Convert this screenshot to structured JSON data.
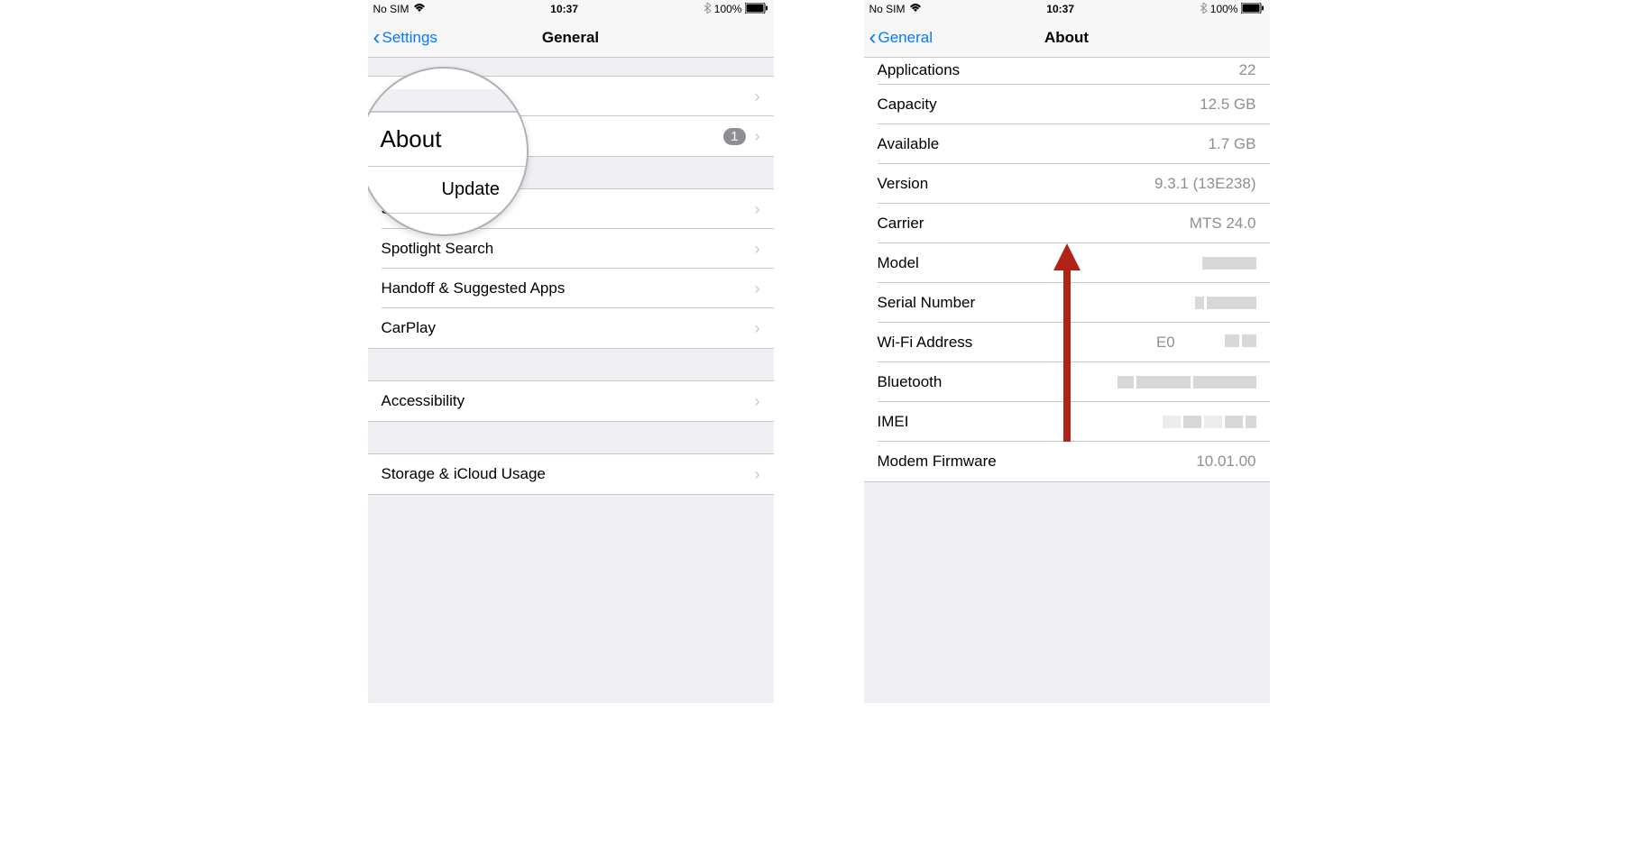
{
  "status": {
    "carrier": "No SIM",
    "time": "10:37",
    "battery": "100%"
  },
  "left": {
    "nav": {
      "back": "Settings",
      "title": "General"
    },
    "section1": [
      {
        "label": "About"
      },
      {
        "label": "Software Update",
        "badge": "1"
      }
    ],
    "section2": [
      {
        "label": "Siri"
      },
      {
        "label": "Spotlight Search"
      },
      {
        "label": "Handoff & Suggested Apps"
      },
      {
        "label": "CarPlay"
      }
    ],
    "section3": [
      {
        "label": "Accessibility"
      }
    ],
    "section4": [
      {
        "label": "Storage & iCloud Usage"
      }
    ],
    "magnifier": {
      "row1": "About",
      "row2": "Update"
    }
  },
  "right": {
    "nav": {
      "back": "General",
      "title": "About"
    },
    "rows": [
      {
        "label": "Applications",
        "value": "22",
        "partial": true
      },
      {
        "label": "Capacity",
        "value": "12.5 GB"
      },
      {
        "label": "Available",
        "value": "1.7 GB"
      },
      {
        "label": "Version",
        "value": "9.3.1 (13E238)"
      },
      {
        "label": "Carrier",
        "value": "MTS 24.0"
      },
      {
        "label": "Model",
        "value": "",
        "redacted": true
      },
      {
        "label": "Serial Number",
        "value": "",
        "redacted": true
      },
      {
        "label": "Wi-Fi Address",
        "value": "E0",
        "redacted": true
      },
      {
        "label": "Bluetooth",
        "value": "",
        "redacted": true
      },
      {
        "label": "IMEI",
        "value": "",
        "redacted": true
      },
      {
        "label": "Modem Firmware",
        "value": "10.01.00"
      }
    ]
  }
}
